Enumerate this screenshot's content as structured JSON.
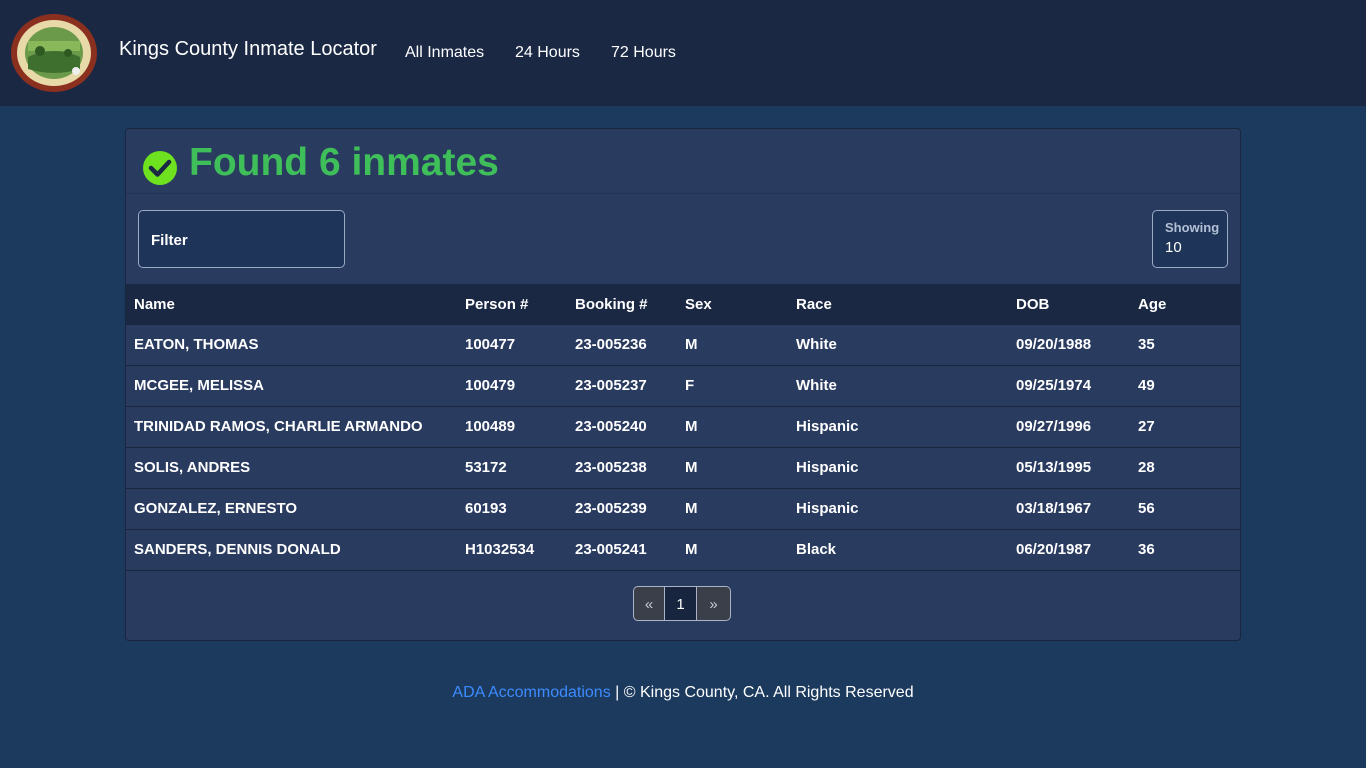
{
  "header": {
    "brand": "Kings County Inmate Locator",
    "nav": [
      "All Inmates",
      "24 Hours",
      "72 Hours"
    ]
  },
  "result": {
    "title": "Found 6 inmates"
  },
  "filter": {
    "label": "Filter"
  },
  "showing": {
    "label": "Showing",
    "value": "10"
  },
  "table": {
    "columns": [
      "Name",
      "Person #",
      "Booking #",
      "Sex",
      "Race",
      "DOB",
      "Age"
    ],
    "rows": [
      [
        "EATON, THOMAS",
        "100477",
        "23-005236",
        "M",
        "White",
        "09/20/1988",
        "35"
      ],
      [
        "MCGEE, MELISSA",
        "100479",
        "23-005237",
        "F",
        "White",
        "09/25/1974",
        "49"
      ],
      [
        "TRINIDAD RAMOS, CHARLIE ARMANDO",
        "100489",
        "23-005240",
        "M",
        "Hispanic",
        "09/27/1996",
        "27"
      ],
      [
        "SOLIS, ANDRES",
        "53172",
        "23-005238",
        "M",
        "Hispanic",
        "05/13/1995",
        "28"
      ],
      [
        "GONZALEZ, ERNESTO",
        "60193",
        "23-005239",
        "M",
        "Hispanic",
        "03/18/1967",
        "56"
      ],
      [
        "SANDERS, DENNIS DONALD",
        "H1032534",
        "23-005241",
        "M",
        "Black",
        "06/20/1987",
        "36"
      ]
    ]
  },
  "pagination": {
    "prev": "«",
    "current": "1",
    "next": "»"
  },
  "footer": {
    "link": "ADA Accommodations",
    "text": " | © Kings County, CA. All Rights Reserved"
  },
  "colors": {
    "accent_green": "#3fbf5a",
    "link_blue": "#3d8bff",
    "header_bg": "#1a2844",
    "page_bg": "#1c3a5e"
  }
}
